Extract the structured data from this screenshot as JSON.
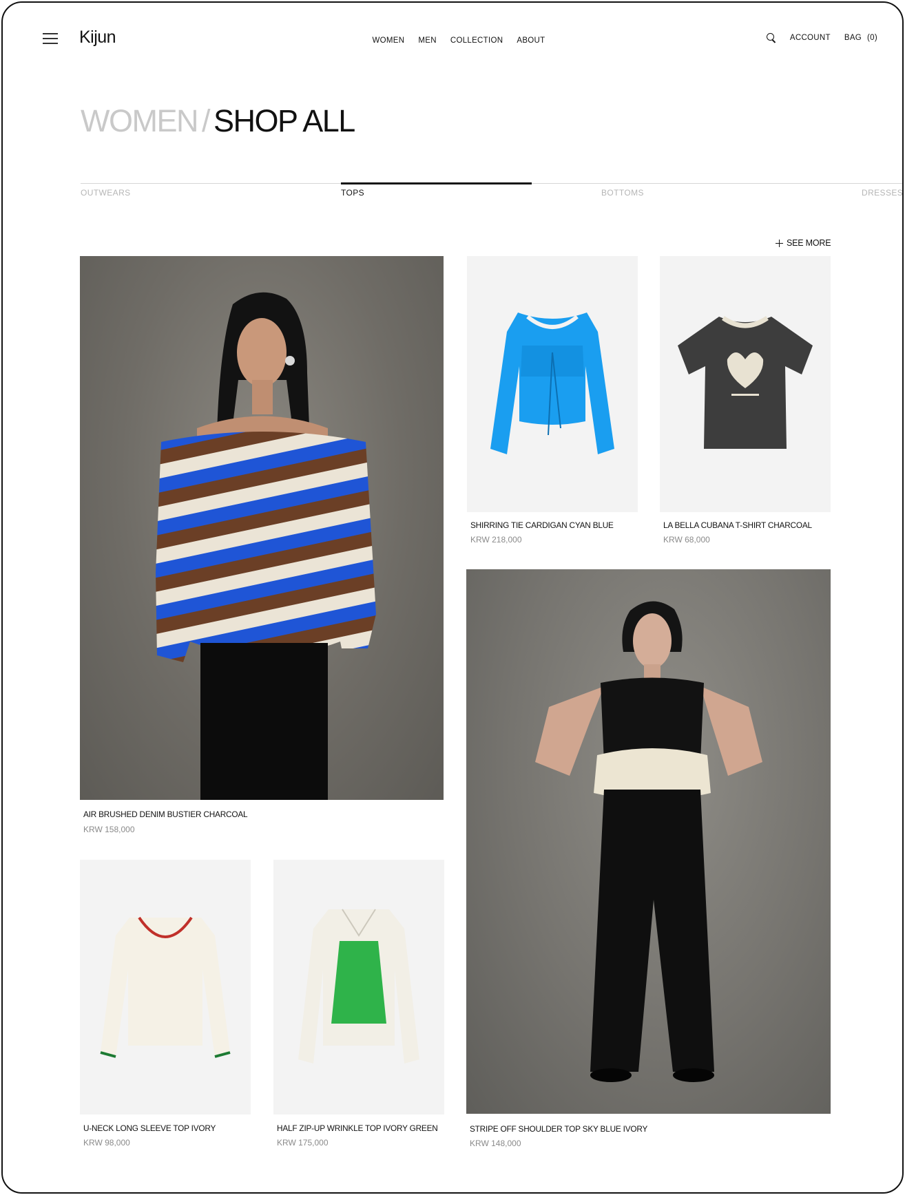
{
  "header": {
    "logo": "Kijun",
    "nav": [
      "WOMEN",
      "MEN",
      "COLLECTION",
      "ABOUT"
    ],
    "account": "ACCOUNT",
    "bag_label": "BAG",
    "bag_count": "(0)"
  },
  "title": {
    "category": "WOMEN",
    "separator": "/",
    "current": "SHOP ALL"
  },
  "tabs": [
    "OUTWEARS",
    "TOPS",
    "BOTTOMS",
    "DRESSES"
  ],
  "active_tab": "TOPS",
  "see_more": "SEE MORE",
  "icons": [
    "menu-icon",
    "search-icon",
    "plus-icon"
  ],
  "products": [
    {
      "name": "AIR BRUSHED DENIM BUSTIER CHARCOAL",
      "price": "KRW 158,000"
    },
    {
      "name": "SHIRRING TIE CARDIGAN CYAN BLUE",
      "price": "KRW 218,000"
    },
    {
      "name": "LA BELLA CUBANA T-SHIRT CHARCOAL",
      "price": "KRW 68,000"
    },
    {
      "name": "STRIPE OFF SHOULDER TOP SKY BLUE IVORY",
      "price": "KRW 148,000"
    },
    {
      "name": "U-NECK LONG SLEEVE TOP IVORY",
      "price": "KRW 98,000"
    },
    {
      "name": "HALF ZIP-UP WRINKLE TOP IVORY GREEN",
      "price": "KRW 175,000"
    }
  ],
  "colors": {
    "text": "#111111",
    "muted": "#c9c9c9",
    "price": "#8a8a8a",
    "cyan_top": "#1d9bf0",
    "green_knit": "#2fb34a"
  }
}
